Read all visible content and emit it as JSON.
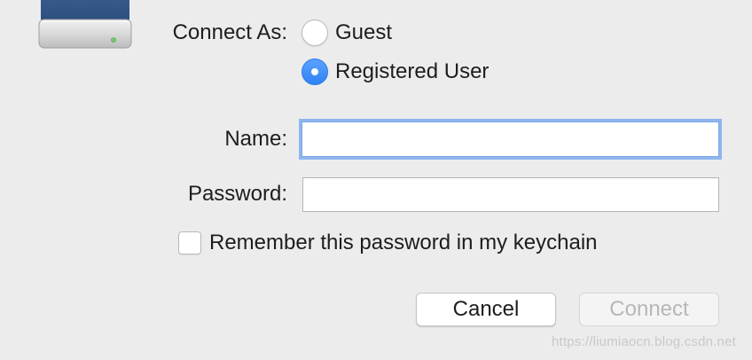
{
  "dialog": {
    "icon": "external-drive-icon",
    "connect_as": {
      "label": "Connect As:",
      "options": [
        {
          "label": "Guest",
          "selected": false
        },
        {
          "label": "Registered User",
          "selected": true
        }
      ]
    },
    "name": {
      "label": "Name:",
      "value": "",
      "focused": true
    },
    "password": {
      "label": "Password:",
      "value": ""
    },
    "remember": {
      "label": "Remember this password in my keychain",
      "checked": false
    },
    "buttons": {
      "cancel": "Cancel",
      "connect": "Connect"
    }
  },
  "watermark": "https://liumiaocn.blog.csdn.net",
  "colors": {
    "background": "#ececec",
    "accent": "#2f82f3",
    "focus_ring": "#8fb6ee",
    "disabled_text": "#b7b7b7"
  }
}
